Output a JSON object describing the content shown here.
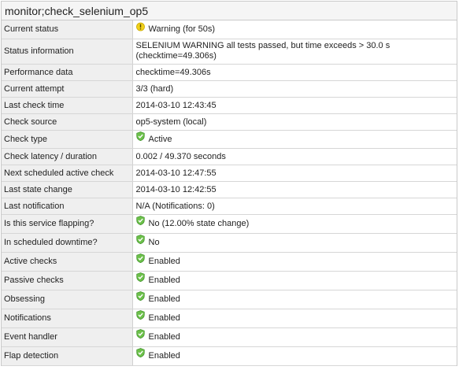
{
  "title": "monitor;check_selenium_op5",
  "rows": [
    {
      "label": "Current status",
      "value": "Warning (for 50s)",
      "icon": "warning-icon"
    },
    {
      "label": "Status information",
      "value_line1": "SELENIUM WARNING all tests passed, but time exceeds > 30.0 s",
      "value_line2": "(checktime=49.306s)"
    },
    {
      "label": "Performance data",
      "value": "checktime=49.306s"
    },
    {
      "label": "Current attempt",
      "value": "3/3 (hard)"
    },
    {
      "label": "Last check time",
      "value": "2014-03-10 12:43:45"
    },
    {
      "label": "Check source",
      "value": "op5-system (local)"
    },
    {
      "label": "Check type",
      "value": "Active",
      "icon": "ok-shield-icon"
    },
    {
      "label": "Check latency / duration",
      "value": "0.002 / 49.370 seconds"
    },
    {
      "label": "Next scheduled active check",
      "value": "2014-03-10 12:47:55"
    },
    {
      "label": "Last state change",
      "value": "2014-03-10 12:42:55"
    },
    {
      "label": "Last notification",
      "value": "N/A (Notifications: 0)"
    },
    {
      "label": "Is this service flapping?",
      "value": "No (12.00% state change)",
      "icon": "ok-shield-icon"
    },
    {
      "label": "In scheduled downtime?",
      "value": "No",
      "icon": "ok-shield-icon"
    },
    {
      "label": "Active checks",
      "value": "Enabled",
      "icon": "ok-shield-icon"
    },
    {
      "label": "Passive checks",
      "value": "Enabled",
      "icon": "ok-shield-icon"
    },
    {
      "label": "Obsessing",
      "value": "Enabled",
      "icon": "ok-shield-icon"
    },
    {
      "label": "Notifications",
      "value": "Enabled",
      "icon": "ok-shield-icon"
    },
    {
      "label": "Event handler",
      "value": "Enabled",
      "icon": "ok-shield-icon"
    },
    {
      "label": "Flap detection",
      "value": "Enabled",
      "icon": "ok-shield-icon"
    }
  ],
  "colors": {
    "warning": "#f2d21b",
    "ok": "#6cc04a"
  }
}
